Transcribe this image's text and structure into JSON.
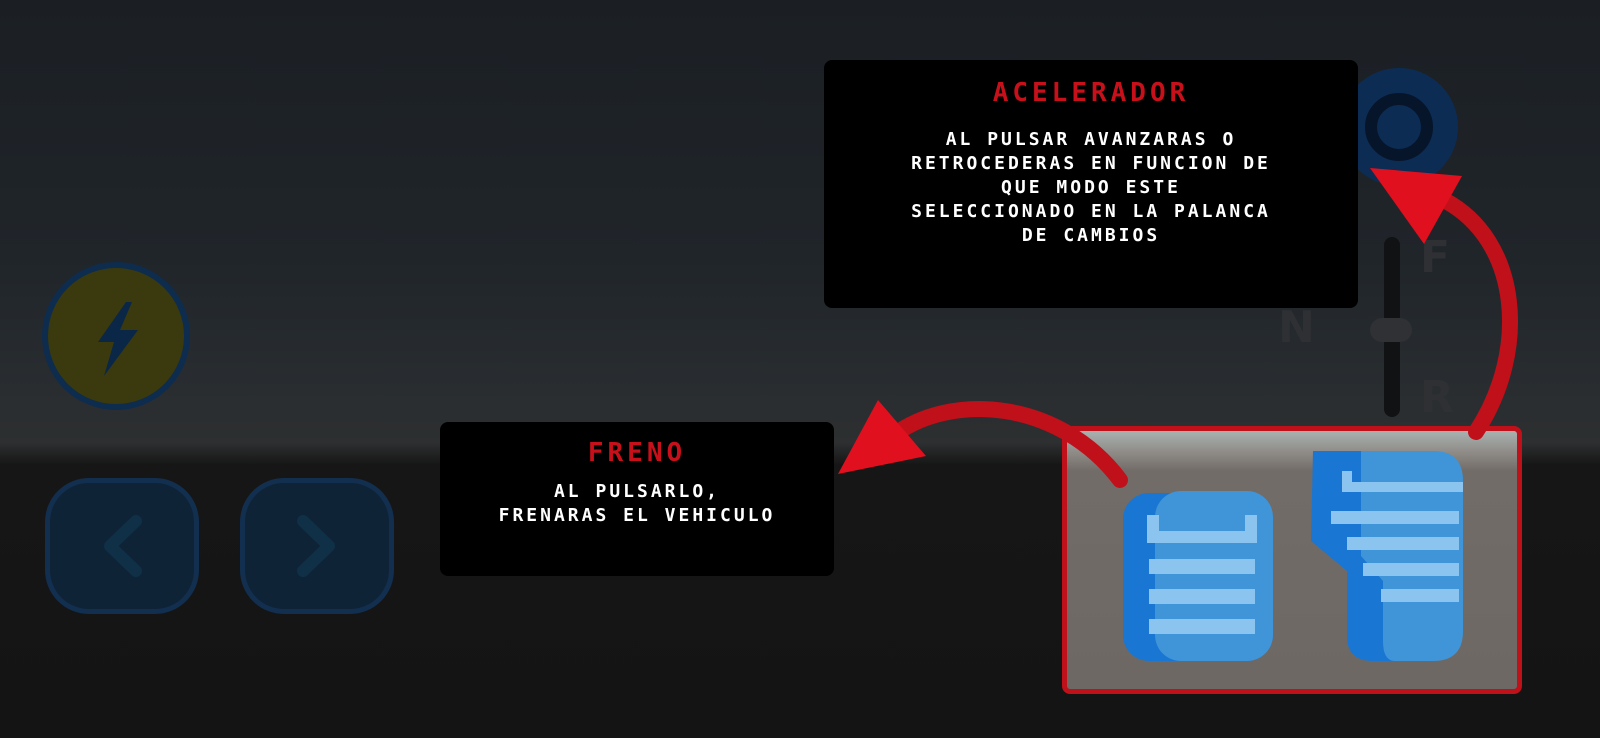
{
  "tooltips": {
    "accelerator": {
      "title": "Acelerador",
      "body": "Al pulsar avanzaras o\nretrocederas en funcion de\nque modo este\nseleccionado en la palanca\nde cambios"
    },
    "brake": {
      "title": "Freno",
      "body": "Al pulsarlo,\nfrenaras el vehiculo"
    }
  },
  "gear_lever": {
    "letters": [
      "F",
      "N",
      "R"
    ]
  },
  "icons": {
    "boost": "lightning-icon",
    "left": "chevron-left-icon",
    "right": "chevron-right-icon",
    "brake": "brake-pedal-icon",
    "accelerator": "accelerator-pedal-icon"
  },
  "colors": {
    "highlight": "#c0101a",
    "title": "#c8101a",
    "pedal_blue": "#1e88e5"
  }
}
